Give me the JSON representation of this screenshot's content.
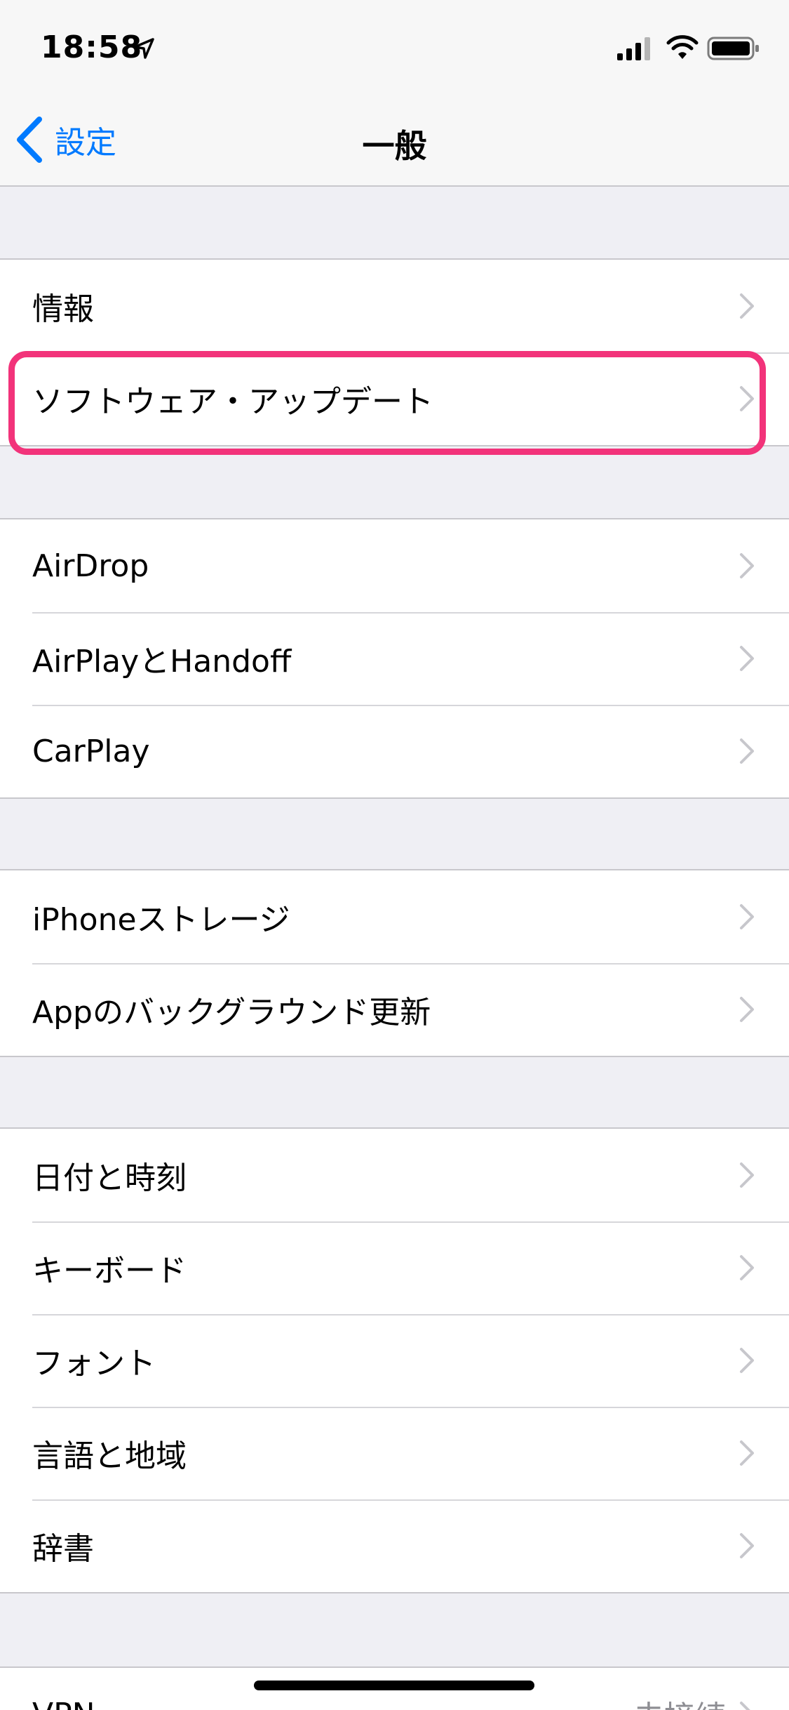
{
  "status_bar": {
    "time": "18:58",
    "icons": [
      "location-arrow-icon",
      "cellular-signal-icon",
      "wifi-icon",
      "battery-icon"
    ]
  },
  "nav": {
    "back_label": "設定",
    "title": "一般"
  },
  "groups": [
    {
      "items": [
        {
          "label": "情報"
        },
        {
          "label": "ソフトウェア・アップデート",
          "highlighted": true
        }
      ]
    },
    {
      "items": [
        {
          "label": "AirDrop"
        },
        {
          "label": "AirPlayとHandoff"
        },
        {
          "label": "CarPlay"
        }
      ]
    },
    {
      "items": [
        {
          "label": "iPhoneストレージ"
        },
        {
          "label": "Appのバックグラウンド更新"
        }
      ]
    },
    {
      "items": [
        {
          "label": "日付と時刻"
        },
        {
          "label": "キーボード"
        },
        {
          "label": "フォント"
        },
        {
          "label": "言語と地域"
        },
        {
          "label": "辞書"
        }
      ]
    },
    {
      "items": [
        {
          "label": "VPN",
          "value": "未接続"
        }
      ]
    }
  ],
  "colors": {
    "accent": "#007aff",
    "highlight": "#f2337a",
    "background": "#efeff4",
    "chevron": "#c7c7cc"
  }
}
